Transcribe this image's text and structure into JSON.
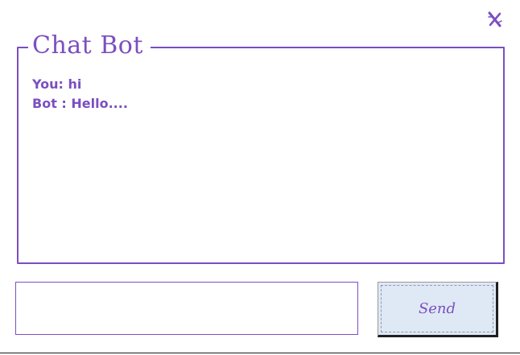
{
  "window": {
    "close_icon": "close-x-icon"
  },
  "chat": {
    "title": "Chat Bot",
    "messages": [
      "You: hi",
      "Bot : Hello...."
    ]
  },
  "composer": {
    "input_value": "",
    "send_label": "Send"
  },
  "colors": {
    "accent": "#7b4fc0",
    "button_face": "#dfe9f5"
  }
}
